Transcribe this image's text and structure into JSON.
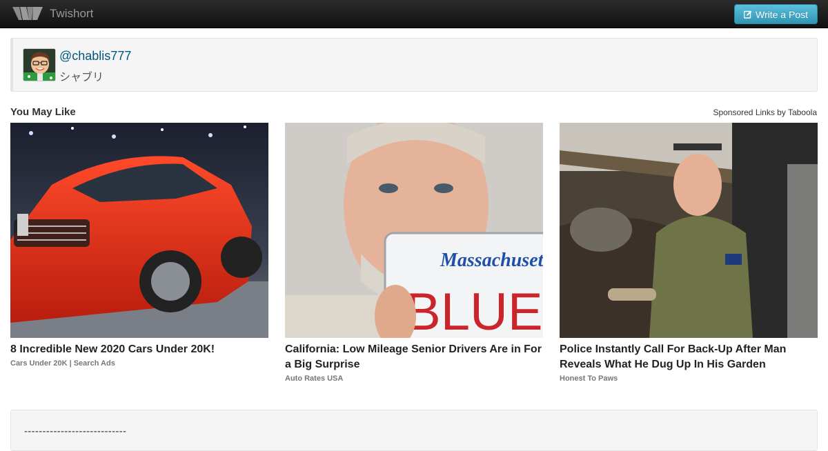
{
  "navbar": {
    "brand_name": "Twishort",
    "write_button_label": "Write a Post"
  },
  "profile": {
    "handle": "@chablis777",
    "display_name": "シャブリ"
  },
  "recommendations": {
    "heading": "You May Like",
    "sponsored_label": "Sponsored Links by Taboola",
    "items": [
      {
        "title": "8 Incredible New 2020 Cars Under 20K!",
        "source": "Cars Under 20K | Search Ads"
      },
      {
        "title": "California: Low Mileage Senior Drivers Are in For a Big Surprise",
        "source": "Auto Rates USA",
        "plate_state": "Massachusetts",
        "plate_text": "BLUE"
      },
      {
        "title": "Police Instantly Call For Back-Up After Man Reveals What He Dug Up In His Garden",
        "source": "Honest To Paws"
      }
    ]
  },
  "post": {
    "separator": "----------------------------"
  },
  "colors": {
    "navbar_bg": "#1b1b1b",
    "button_accent": "#49afcd",
    "link": "#005580"
  }
}
